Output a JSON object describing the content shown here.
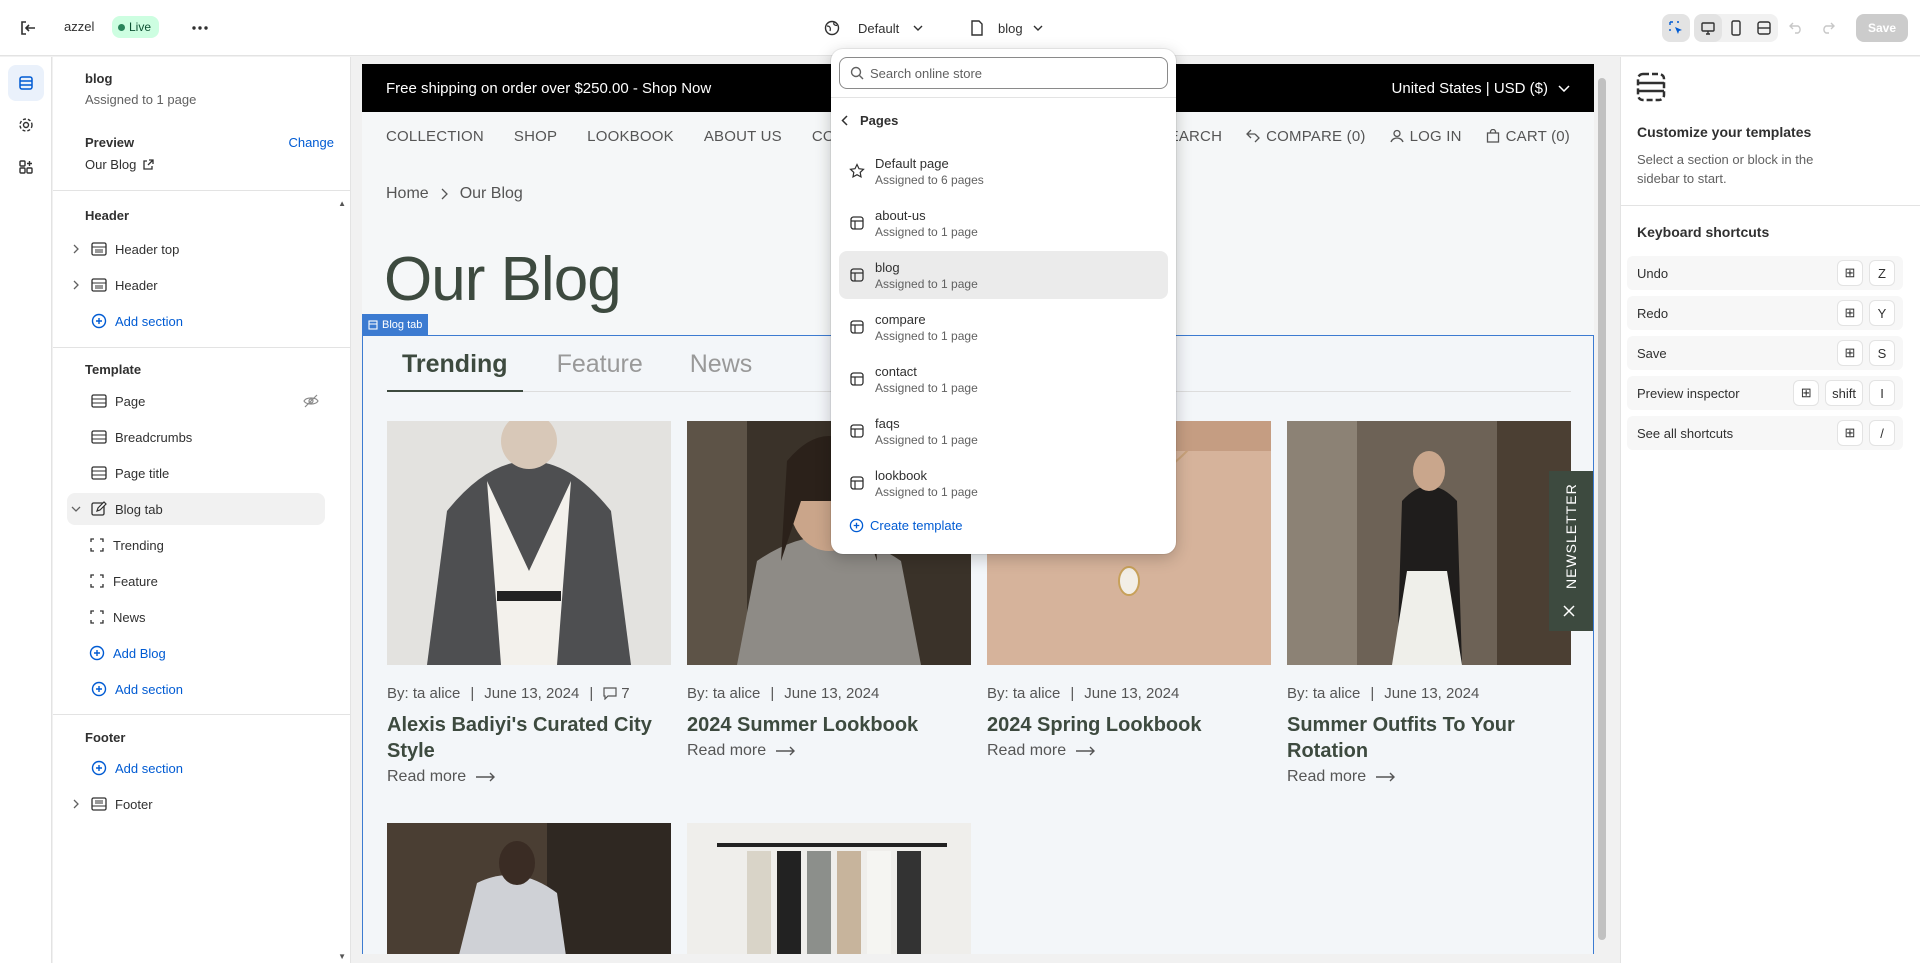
{
  "topbar": {
    "store_name": "azzel",
    "live_badge": "Live",
    "theme_select": "Default",
    "template_select": "blog",
    "save_label": "Save"
  },
  "sidebar": {
    "template_name": "blog",
    "assigned": "Assigned to 1 page",
    "preview_label": "Preview",
    "change_label": "Change",
    "preview_value": "Our Blog",
    "header_group": "Header",
    "header_items": [
      "Header top",
      "Header"
    ],
    "add_section": "Add section",
    "template_group": "Template",
    "template_items": [
      "Page",
      "Breadcrumbs",
      "Page title",
      "Blog tab"
    ],
    "blog_children": [
      "Trending",
      "Feature",
      "News"
    ],
    "add_blog": "Add Blog",
    "footer_group": "Footer",
    "footer_items": [
      "Footer"
    ]
  },
  "store": {
    "announcement": "Free shipping on order over $250.00 - Shop Now",
    "region": "United States | USD ($)",
    "nav_left": [
      "COLLECTION",
      "SHOP",
      "LOOKBOOK",
      "ABOUT US",
      "CONTACT US"
    ],
    "nav_search": "SEARCH",
    "nav_compare": "COMPARE (0)",
    "nav_login": "LOG IN",
    "nav_cart": "CART (0)",
    "crumb_home": "Home",
    "crumb_current": "Our Blog",
    "heading": "Our Blog",
    "selection_tag": "Blog tab",
    "tabs": [
      "Trending",
      "Feature",
      "News"
    ],
    "posts": [
      {
        "author": "By: ta alice",
        "date": "June 13, 2024",
        "comments": "7",
        "title": "Alexis Badiyi's Curated City Style",
        "read_more": "Read more"
      },
      {
        "author": "By: ta alice",
        "date": "June 13, 2024",
        "title": "2024 Summer Lookbook",
        "read_more": "Read more"
      },
      {
        "author": "By: ta alice",
        "date": "June 13, 2024",
        "title": "2024 Spring Lookbook",
        "read_more": "Read more"
      },
      {
        "author": "By: ta alice",
        "date": "June 13, 2024",
        "title": "Summer Outfits To Your Rotation",
        "read_more": "Read more"
      }
    ],
    "newsletter": "NEWSLETTER"
  },
  "right_panel": {
    "title": "Customize your templates",
    "description": "Select a section or block in the sidebar to start.",
    "shortcuts_title": "Keyboard shortcuts",
    "shortcuts": [
      {
        "label": "Undo",
        "keys": [
          "Z"
        ]
      },
      {
        "label": "Redo",
        "keys": [
          "Y"
        ]
      },
      {
        "label": "Save",
        "keys": [
          "S"
        ]
      },
      {
        "label": "Preview inspector",
        "keys": [
          "shift",
          "I"
        ]
      },
      {
        "label": "See all shortcuts",
        "keys": [
          "/"
        ]
      }
    ]
  },
  "dropdown": {
    "search_placeholder": "Search online store",
    "heading": "Pages",
    "items": [
      {
        "name": "Default page",
        "sub": "Assigned to 6 pages"
      },
      {
        "name": "about-us",
        "sub": "Assigned to 1 page"
      },
      {
        "name": "blog",
        "sub": "Assigned to 1 page"
      },
      {
        "name": "compare",
        "sub": "Assigned to 1 page"
      },
      {
        "name": "contact",
        "sub": "Assigned to 1 page"
      },
      {
        "name": "faqs",
        "sub": "Assigned to 1 page"
      },
      {
        "name": "lookbook",
        "sub": "Assigned to 1 page"
      }
    ],
    "create_label": "Create template"
  },
  "colors": {
    "accent": "#005bd3",
    "selection": "#3c7bd1",
    "brand_dark": "#3d4a3f",
    "live_bg": "#cdfee1"
  }
}
